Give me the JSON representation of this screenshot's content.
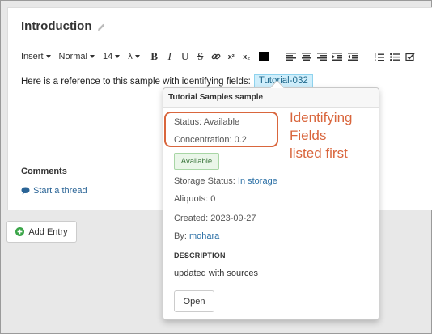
{
  "entry": {
    "title": "Introduction",
    "toolbar": {
      "insert_label": "Insert",
      "style_label": "Normal",
      "size_label": "14",
      "lambda_label": "λ",
      "bold": "B",
      "italic": "I",
      "underline": "U",
      "strike": "S",
      "superscript": "x²",
      "subscript": "x₂"
    },
    "body_text": "Here is a reference to this sample with identifying fields:",
    "tag_label": "Tutorial-032",
    "comments_label": "Comments",
    "start_thread_label": "Start a thread"
  },
  "add_entry_label": "Add Entry",
  "popover": {
    "header": "Tutorial Samples sample",
    "status_label": "Status:",
    "status_value": "Available",
    "concentration_label": "Concentration:",
    "concentration_value": "0.2",
    "badge": "Available",
    "storage_label": "Storage Status:",
    "storage_value": "In storage",
    "aliquots_label": "Aliquots:",
    "aliquots_value": "0",
    "created_label": "Created:",
    "created_value": "2023-09-27",
    "by_label": "By:",
    "by_value": "mohara",
    "description_label": "DESCRIPTION",
    "description_value": "updated with sources",
    "open_label": "Open"
  },
  "annotation": {
    "line1": "Identifying",
    "line2": "Fields",
    "line3": "listed first",
    "color": "#d9663d"
  },
  "icons": {
    "pencil": "pencil-icon",
    "comment": "comment-icon",
    "add": "plus-circle-icon"
  }
}
